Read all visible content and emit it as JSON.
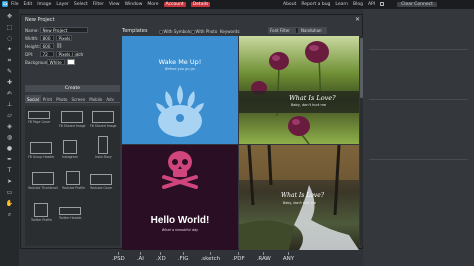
{
  "menubar": {
    "items": [
      "File",
      "Edit",
      "Image",
      "Layer",
      "Select",
      "Filter",
      "View",
      "Window",
      "More"
    ],
    "account_label": "Account",
    "details_label": "Details",
    "right": [
      "About",
      "Report a bug",
      "Learn",
      "Blog",
      "API"
    ],
    "connect_label": "Clear Connect"
  },
  "dialog": {
    "title": "New Project",
    "close_glyph": "✕",
    "form": {
      "name_label": "Name:",
      "name_value": "New Project",
      "width_label": "Width:",
      "width_value": "800",
      "height_label": "Height:",
      "height_value": "600",
      "dpi_label": "DPI:",
      "dpi_value": "72",
      "unit": "Pixels",
      "dpi_unit": "Pixels / inch",
      "background_label": "Background:",
      "background_value": "White",
      "create_label": "Create"
    },
    "tabs": [
      "Social",
      "Print",
      "Photo",
      "Screen",
      "Mobile",
      "Adv"
    ],
    "presets": [
      {
        "label": "FB Page Cover",
        "kind": "wide"
      },
      {
        "label": "FB Shared Image",
        "kind": "wide"
      },
      {
        "label": "FB Shared Image",
        "kind": "wide"
      },
      {
        "label": "FB Group Header",
        "kind": "wide"
      },
      {
        "label": "Instagram",
        "kind": "square"
      },
      {
        "label": "Insta Story",
        "kind": "tall"
      },
      {
        "label": "Youtube Thumbnail",
        "kind": "wide"
      },
      {
        "label": "Youtube Profile",
        "kind": "square"
      },
      {
        "label": "Youtube Cover",
        "kind": "wide"
      },
      {
        "label": "Twitter Profile",
        "kind": "square"
      },
      {
        "label": "Twitter Header",
        "kind": "banner"
      }
    ]
  },
  "templates": {
    "title": "Templates",
    "with_symbols_label": "With Symbols",
    "with_photo_label": "With Photo",
    "keywords_label": "Keywords:",
    "font_filter_label": "Font Filter",
    "font_value": "Nanduhan",
    "cards": [
      {
        "title": "Wake Me Up!",
        "subtitle": "Before you go go",
        "bg": "#3b8fd0"
      },
      {
        "title": "What Is Love?",
        "subtitle": "Baby, don't hurt me",
        "bg": "#3b4a1e"
      },
      {
        "title": "Hello World!",
        "subtitle": "What a beautiful day",
        "bg": "#2a0f24"
      },
      {
        "title": "What Is Love?",
        "subtitle": "Baby, don't hurt me",
        "bg": "#3a3628"
      }
    ]
  },
  "formats": [
    ".PSD",
    ".AI",
    ".XD",
    ".FIG",
    ".sketch",
    ".PDF",
    ".RAW",
    "ANY"
  ],
  "colors": {
    "accent": "#c7323b",
    "bg": "#2f3337",
    "panel": "#33373b"
  }
}
